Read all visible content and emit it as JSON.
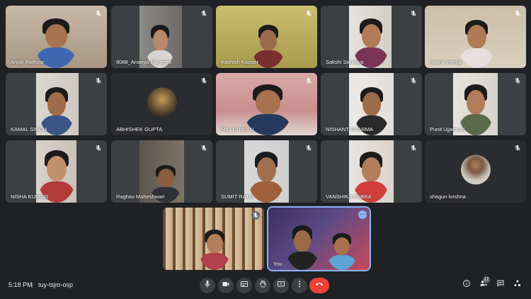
{
  "colors": {
    "background": "#202124",
    "tile": "#3c4043",
    "end_call": "#ea4335",
    "accent": "#8ab4f8"
  },
  "participants": [
    {
      "name": "Anjali Rathour"
    },
    {
      "name": "8088_Ananya Banerjee"
    },
    {
      "name": "Kashish Kapoor"
    },
    {
      "name": "Sakshi Sandilya"
    },
    {
      "name": "Aakriti Verma"
    },
    {
      "name": "KAMAL SINGH"
    },
    {
      "name": "ABHISHEK GUPTA"
    },
    {
      "name": "MILI DHIMAN"
    },
    {
      "name": "NISHANT SHARMA"
    },
    {
      "name": "Punit Ujjainwal"
    },
    {
      "name": "NISHA KUMARI"
    },
    {
      "name": "Raghav Maheshwari"
    },
    {
      "name": "SUMIT RATHI"
    },
    {
      "name": "VANSHIKA KABRA"
    },
    {
      "name": "shagun krishna"
    }
  ],
  "self_tile": {
    "name": "You"
  },
  "bottom_bar": {
    "time": "5:18 PM",
    "separator": "|",
    "meeting_code": "tuy-tsjm-osp",
    "participant_count": "17"
  },
  "icons": {
    "mic": "mic-icon",
    "camera": "camera-icon",
    "captions": "captions-icon",
    "raise_hand": "raise-hand-icon",
    "present": "present-screen-icon",
    "more": "more-options-icon",
    "end_call": "end-call-icon",
    "info": "info-icon",
    "people": "people-icon",
    "chat": "chat-icon",
    "activities": "activities-icon"
  }
}
